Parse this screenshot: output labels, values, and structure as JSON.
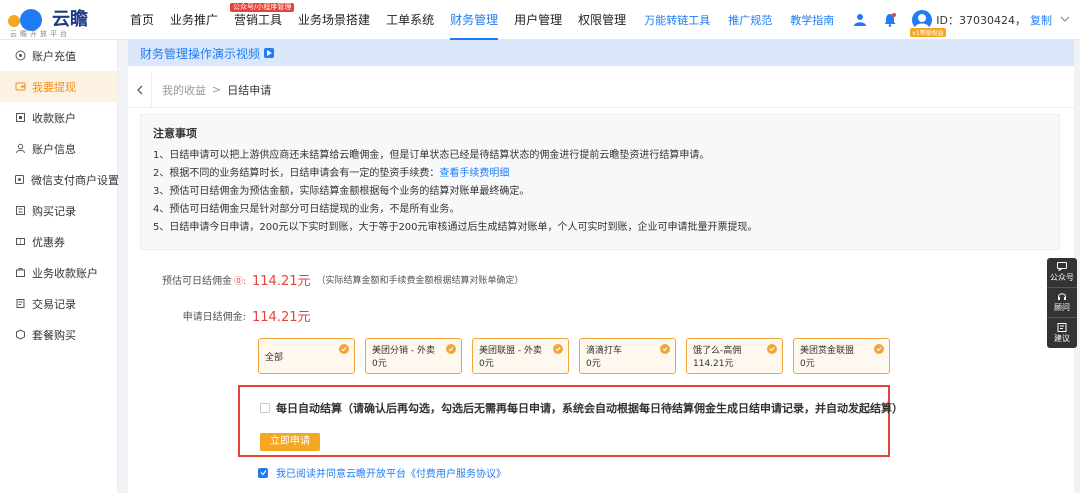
{
  "logo": {
    "text": "云瞻",
    "subtitle": "云瞻开放平台"
  },
  "nav": {
    "items": [
      {
        "label": "首页"
      },
      {
        "label": "业务推广"
      },
      {
        "label": "营销工具",
        "badge": "公众号/小程序管理"
      },
      {
        "label": "业务场景搭建"
      },
      {
        "label": "工单系统"
      },
      {
        "label": "财务管理",
        "active": true
      },
      {
        "label": "用户管理"
      },
      {
        "label": "权限管理"
      }
    ]
  },
  "top_right": {
    "links": [
      "万能转链工具",
      "推广规范",
      "教学指南"
    ],
    "user_id": "ID：37030424，",
    "copy": "复制",
    "avatar_tag": "v1等级权益"
  },
  "sidebar": {
    "items": [
      {
        "label": "账户充值",
        "icon": "coin-icon"
      },
      {
        "label": "我要提现",
        "icon": "wallet-icon",
        "active": true
      },
      {
        "label": "收款账户",
        "icon": "account-icon"
      },
      {
        "label": "账户信息",
        "icon": "user-icon"
      },
      {
        "label": "微信支付商户设置",
        "icon": "settings-icon"
      },
      {
        "label": "购买记录",
        "icon": "record-icon"
      },
      {
        "label": "优惠券",
        "icon": "coupon-icon"
      },
      {
        "label": "业务收款账户",
        "icon": "business-account-icon"
      },
      {
        "label": "交易记录",
        "icon": "transaction-icon"
      },
      {
        "label": "套餐购买",
        "icon": "package-icon"
      }
    ]
  },
  "video_bar": {
    "label": "财务管理操作演示视频"
  },
  "breadcrumb": {
    "parent": "我的收益",
    "sep": ">",
    "current": "日结申请"
  },
  "notice": {
    "title": "注意事项",
    "lines": [
      "1、日结申请可以把上游供应商还未结算给云瞻佣金，但是订单状态已经是待结算状态的佣金进行提前云瞻垫资进行结算申请。",
      "2、根据不同的业务结算时长，日结申请会有一定的垫资手续费：",
      "3、预估可日结佣金为预估金额，实际结算金额根据每个业务的结算对账单最终确定。",
      "4、预估可日结佣金只是针对部分可日结提现的业务，不是所有业务。",
      "5、日结申请今日申请，200元以下实时到账，大于等于200元审核通过后生成结算对账单，个人可实时到账，企业可申请批量开票提现。"
    ],
    "fee_link": "查看手续费明细"
  },
  "estimate": {
    "label": "预估可日结佣金",
    "q": "⓪:",
    "amount": "114.21元",
    "note": "（实际结算金额和手续费金额根据结算对账单确定）"
  },
  "apply_amount": {
    "label": "申请日结佣金:",
    "amount": "114.21元"
  },
  "cards": [
    {
      "name": "全部",
      "value": ""
    },
    {
      "name": "美团分销 - 外卖",
      "value": "0元"
    },
    {
      "name": "美团联盟 - 外卖",
      "value": "0元"
    },
    {
      "name": "滴滴打车",
      "value": "0元"
    },
    {
      "name": "饿了么-高佣",
      "value": "114.21元"
    },
    {
      "name": "美团赏金联盟",
      "value": "0元"
    }
  ],
  "auto_settle": {
    "text": "每日自动结算（请确认后再勾选，勾选后无需再每日申请，系统会自动根据每日待结算佣金生成日结申请记录，并自动发起结算）",
    "button": "立即申请"
  },
  "agreement": {
    "text": "我已阅读并同意云瞻开放平台《付费用户服务协议》"
  },
  "float_panel": {
    "items": [
      {
        "label": "公众号",
        "icon": "wechat-official-icon"
      },
      {
        "label": "顾问",
        "icon": "headset-icon"
      },
      {
        "label": "建议",
        "icon": "feedback-icon"
      }
    ]
  },
  "colors": {
    "primary": "#1f7cf5",
    "accent": "#f5a623",
    "danger": "#e5433a"
  }
}
